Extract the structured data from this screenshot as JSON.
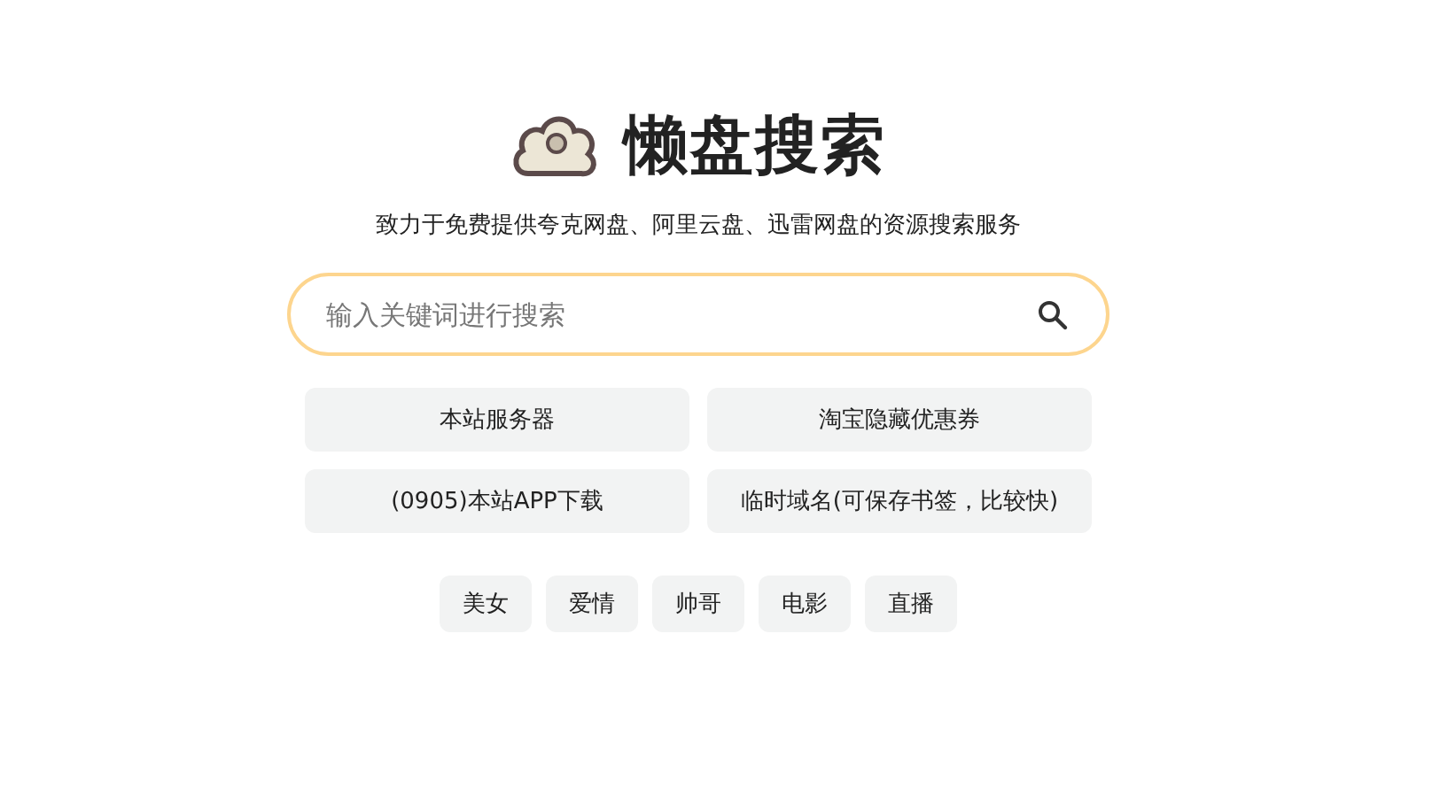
{
  "brand": {
    "title": "懒盘搜索",
    "subtitle": "致力于免费提供夸克网盘、阿里云盘、迅雷网盘的资源搜索服务"
  },
  "search": {
    "placeholder": "输入关键词进行搜索"
  },
  "links": [
    "本站服务器",
    "淘宝隐藏优惠券",
    "(0905)本站APP下载",
    "临时域名(可保存书签，比较快)"
  ],
  "tags": [
    "美女",
    "爱情",
    "帅哥",
    "电影",
    "直播"
  ]
}
